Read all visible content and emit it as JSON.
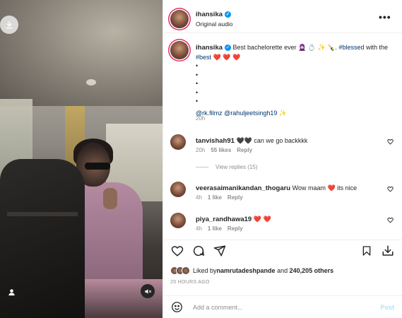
{
  "post": {
    "username": "ihansika",
    "audio": "Original audio",
    "more": "•••"
  },
  "caption": {
    "username": "ihansika",
    "text_main": "Best bachelorette ever 🧕🏻 💍 ✨ 🍾. ",
    "hashtag1": "#blessed",
    "with_text": " with the ",
    "hashtag2": "#best",
    "hearts": " ❤️ ❤️ ❤️",
    "dots": [
      "•",
      "•",
      "•",
      "•",
      "•"
    ],
    "mention1": "@rk.filmz",
    "mention2": "@rahuljeetsingh19",
    "sparkle": " ✨",
    "time": "20h"
  },
  "comments": [
    {
      "username": "tanvishah91",
      "text": "🖤🖤 can we go backkkk",
      "time": "20h",
      "likes": "55 likes",
      "reply": "Reply",
      "view_replies": "View replies (15)"
    },
    {
      "username": "veerasaimanikandan_thogaru",
      "text": "Wow maam ❤️ its nice",
      "time": "4h",
      "likes": "1 like",
      "reply": "Reply"
    },
    {
      "username": "piya_randhawa19",
      "text": "❤️ ❤️",
      "time": "4h",
      "likes": "1 like",
      "reply": "Reply"
    }
  ],
  "likes": {
    "prefix": "Liked by ",
    "user": "namrutadeshpande",
    "middle": " and ",
    "count": "240,205 others"
  },
  "date": "20 HOURS AGO",
  "add_comment": {
    "placeholder": "Add a comment...",
    "post_label": "Post"
  },
  "icons": {
    "download": "download-icon",
    "user": "user-tag-icon",
    "sound": "speaker-muted-icon",
    "like": "heart-icon",
    "comment": "comment-icon",
    "share": "send-icon",
    "save": "bookmark-icon",
    "emoji": "emoji-icon"
  },
  "colors": {
    "accent": "#0095f6",
    "heart": "#ed4956",
    "link": "#00376b",
    "muted": "#8e8e8e"
  }
}
